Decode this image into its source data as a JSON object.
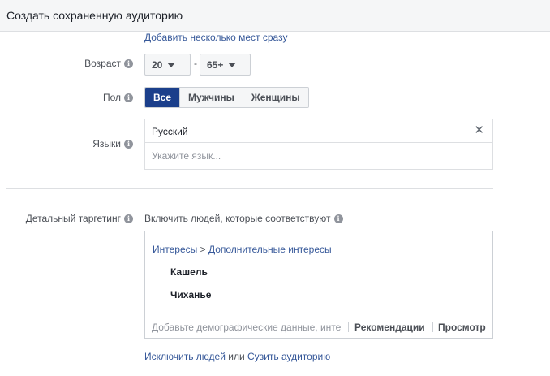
{
  "header": {
    "title": "Создать сохраненную аудиторию"
  },
  "location": {
    "add_multiple_link": "Добавить несколько мест сразу"
  },
  "age": {
    "label": "Возраст",
    "min": "20",
    "max": "65+"
  },
  "gender": {
    "label": "Пол",
    "options": [
      "Все",
      "Мужчины",
      "Женщины"
    ],
    "selected": "Все"
  },
  "languages": {
    "label": "Языки",
    "selected": [
      "Русский"
    ],
    "placeholder": "Укажите язык..."
  },
  "detailed_targeting": {
    "label": "Детальный таргетинг",
    "caption": "Включить людей, которые соответствуют",
    "path": {
      "category": "Интересы",
      "separator": " > ",
      "subcategory": "Дополнительные интересы"
    },
    "items": [
      "Кашель",
      "Чиханье"
    ],
    "input_placeholder": "Добавьте демографические данные, инте",
    "recommendations_label": "Рекомендации",
    "browse_label": "Просмотр"
  },
  "footer": {
    "exclude_link": "Исключить людей",
    "or_text": " или ",
    "narrow_link": "Сузить аудиторию"
  },
  "colors": {
    "accent": "#1b3f8b",
    "link": "#365899",
    "header_bg": "#f5f6f7",
    "border": "#ccd0d5"
  }
}
